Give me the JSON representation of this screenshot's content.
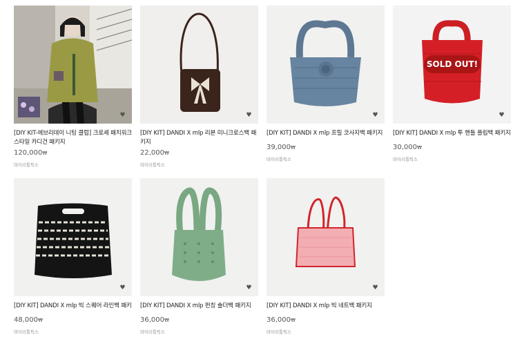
{
  "products": [
    {
      "title": "[DIY KIT-에브리데이 니팅 클럽] 크로셰 패치워크 스타일 카디건 패키지",
      "price": "120,000",
      "currency": "₩",
      "seller": "마이리틀픽스",
      "sold_out": false
    },
    {
      "title": "[DIY KIT] DANDI X mlp 리본 미니크로스백 패키지",
      "price": "22,000",
      "currency": "₩",
      "seller": "마이리틀픽스",
      "sold_out": false
    },
    {
      "title": "[DIY KIT] DANDI X mlp 프릴 코사지백 패키지",
      "price": "39,000",
      "currency": "₩",
      "seller": "마이리틀픽스",
      "sold_out": false
    },
    {
      "title": "[DIY KIT] DANDI X mlp 투 핸들 플립백 패키지",
      "price": "30,000",
      "currency": "₩",
      "seller": "마이리틀픽스",
      "sold_out": true,
      "sold_out_label": "SOLD OUT!"
    },
    {
      "title": "[DIY KIT] DANDI X mlp 빅 스퀘어 라인백 패키지",
      "price": "48,000",
      "currency": "₩",
      "seller": "마이리틀픽스",
      "sold_out": false
    },
    {
      "title": "[DIY KIT] DANDI X mlp 펀칭 숄더백 패키지",
      "price": "36,000",
      "currency": "₩",
      "seller": "마이리틀픽스",
      "sold_out": false
    },
    {
      "title": "[DIY KIT] DANDI X mlp 빅 네트백 패키지",
      "price": "36,000",
      "currency": "₩",
      "seller": "마이리틀픽스",
      "sold_out": false
    }
  ],
  "icons": {
    "wishlist": "heart-icon"
  }
}
